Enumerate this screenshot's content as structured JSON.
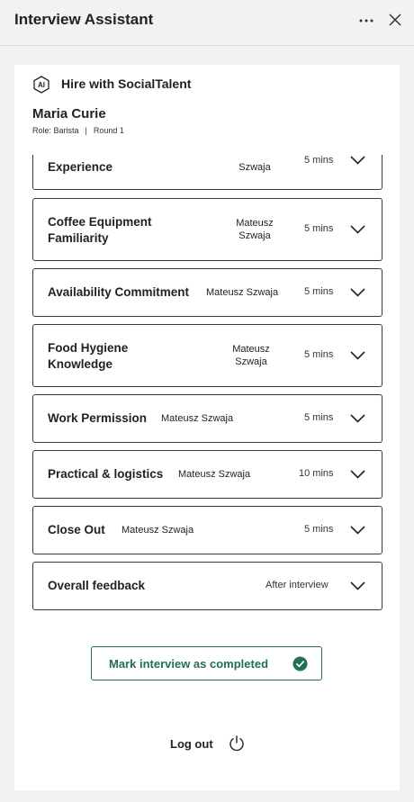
{
  "header": {
    "title": "Interview Assistant"
  },
  "brand": {
    "icon_text": "AI",
    "name": "Hire with SocialTalent"
  },
  "candidate": {
    "name": "Maria Curie",
    "role": "Role: Barista",
    "separator": "|",
    "round": "Round 1"
  },
  "sections": [
    {
      "label": "Experience",
      "interviewer": "Szwaja",
      "duration": "5 mins"
    },
    {
      "label": "Coffee Equipment Familiarity",
      "interviewer": "Mateusz Szwaja",
      "duration": "5 mins"
    },
    {
      "label": "Availability Commitment",
      "interviewer": "Mateusz Szwaja",
      "duration": "5 mins"
    },
    {
      "label": "Food Hygiene Knowledge",
      "interviewer": "Mateusz Szwaja",
      "duration": "5 mins"
    },
    {
      "label": "Work Permission",
      "interviewer": "Mateusz Szwaja",
      "duration": "5 mins"
    },
    {
      "label": "Practical & logistics",
      "interviewer": "Mateusz Szwaja",
      "duration": "10 mins"
    },
    {
      "label": "Close Out",
      "interviewer": "Mateusz Szwaja",
      "duration": "5 mins"
    },
    {
      "label": "Overall feedback",
      "interviewer": "",
      "duration": "After interview"
    }
  ],
  "actions": {
    "complete_label": "Mark interview as completed",
    "logout_label": "Log out"
  },
  "colors": {
    "accent": "#1f6f5c",
    "background": "#f3f2f1"
  }
}
